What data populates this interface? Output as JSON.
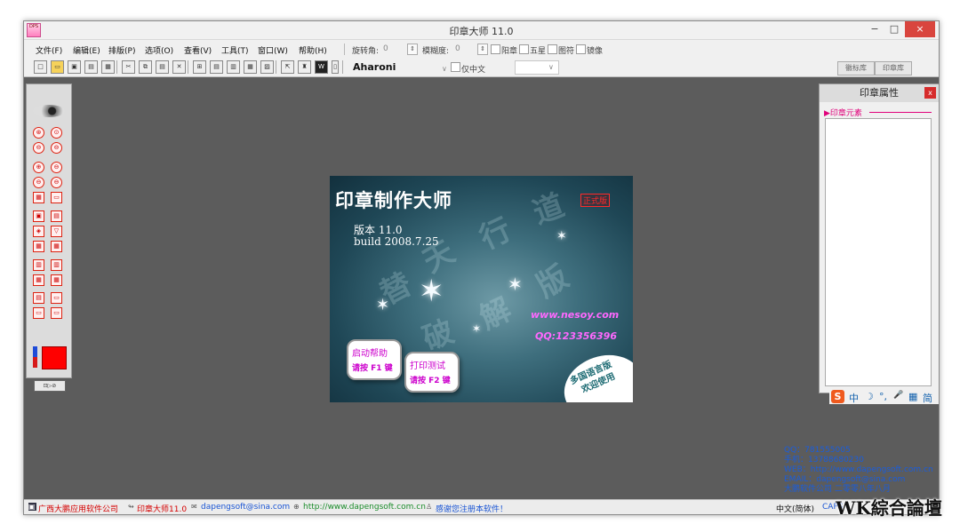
{
  "window": {
    "title": "印章大师 11.0",
    "controls": {
      "minimize": "−",
      "maximize": "□",
      "close": "×"
    }
  },
  "menubar": {
    "items": [
      "文件(F)",
      "编辑(E)",
      "排版(P)",
      "选项(O)",
      "查看(V)",
      "工具(T)",
      "窗口(W)",
      "帮助(H)"
    ],
    "rotation_label": "旋转角:",
    "rotation_value": "0",
    "blur_label": "模糊度:",
    "blur_value": "0",
    "checks": [
      "阳章",
      "五星",
      "图符",
      "镜像"
    ]
  },
  "toolbar": {
    "font_name": "Aharoni",
    "only_chinese_label": "仅中文",
    "tabs": [
      "徽标库",
      "印章库"
    ]
  },
  "palette": {
    "buttons": [
      "⊛",
      "⊙",
      "⊖",
      "⊖",
      "⊕",
      "⊖",
      "⊖",
      "⊖",
      "▦",
      "▭",
      "▣",
      "▤",
      "◈",
      "▽",
      "▦",
      "▦",
      "▥",
      "▥",
      "▦",
      "▦",
      "▤",
      "▭",
      "▭",
      "▭"
    ],
    "footer": "⊡▷⊘"
  },
  "splash": {
    "title": "印章制作大师",
    "badge": "正式版",
    "version": "版本 11.0",
    "build": "build 2008.7.25",
    "website": "www.nesoy.com",
    "qq": "QQ:123356396",
    "help_button": {
      "line1": "启动帮助",
      "line2": "请按 F1 键"
    },
    "print_button": {
      "line1": "打印测试",
      "line2": "请按 F2 键"
    },
    "multilang": [
      "多国语言版",
      "欢迎使用"
    ],
    "ghost_text": [
      "替",
      "天",
      "行",
      "道",
      "破",
      "解",
      "版"
    ]
  },
  "properties_panel": {
    "title": "印章属性",
    "close": "x",
    "section": "▶印章元素"
  },
  "ime_bar": {
    "logo": "S",
    "items": [
      "中",
      "☽",
      "°,",
      "🎤",
      "▦",
      "简"
    ]
  },
  "contact_info": [
    "QQ：781555005",
    "手机：13788680230",
    "WEB：http://www.dapengsoft.com.cn",
    "EMAIL：dapengsoft@sina.com",
    "大鹏软件公司 二零零八年八月"
  ],
  "statusbar": {
    "company": "广西大鹏应用软件公司",
    "product": "印章大师11.0",
    "email": "dapengsoft@sina.com",
    "website": "http://www.dapengsoft.com.cn",
    "thanks": "感谢您注册本软件！",
    "lang": "中文(简体)",
    "caps": "CAPS"
  },
  "watermark": "WK綜合論壇"
}
